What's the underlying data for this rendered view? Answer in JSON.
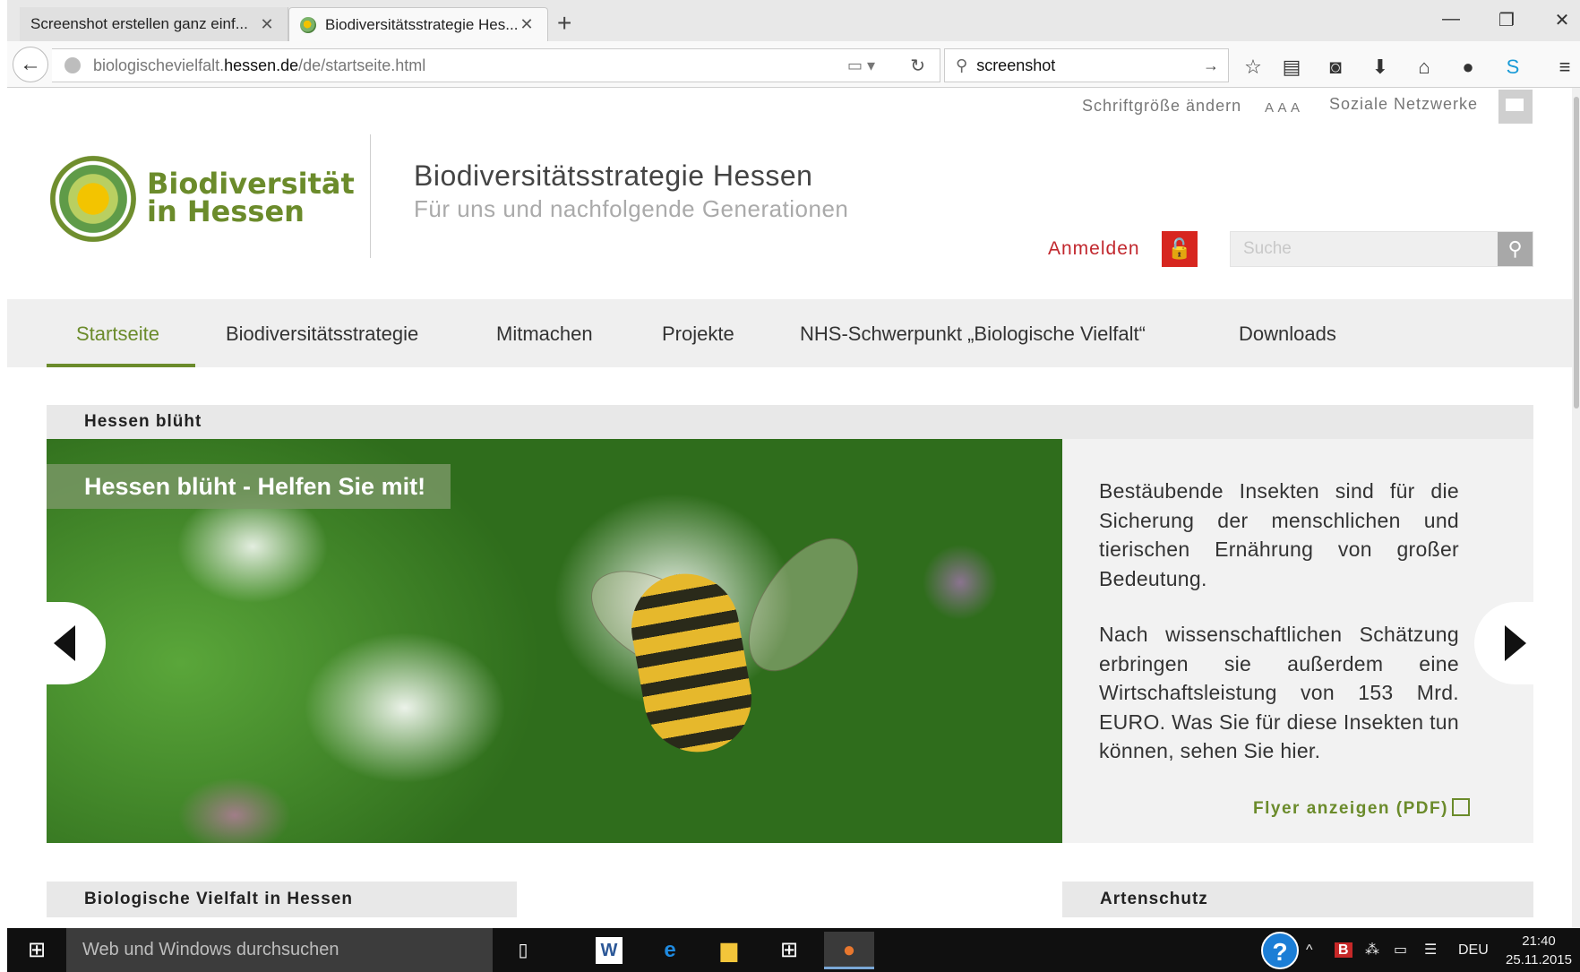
{
  "browser": {
    "tabs": [
      {
        "label": "Screenshot erstellen ganz einf...",
        "active": false
      },
      {
        "label": "Biodiversitätsstrategie Hes...",
        "active": true
      }
    ],
    "url": {
      "prefix": "biologischevielfalt.",
      "host": "hessen.de",
      "path": "/de/startseite.html"
    },
    "search_value": "screenshot",
    "icons": [
      "back-arrow-icon",
      "reader-icon",
      "reload-icon",
      "search-icon",
      "star-icon",
      "library-icon",
      "pocket-icon",
      "download-icon",
      "home-icon",
      "chat-icon",
      "skype-icon",
      "menu-icon"
    ]
  },
  "site": {
    "util": {
      "font_size": "Schriftgröße ändern",
      "font_size_controls": "A A A",
      "social": "Soziale Netzwerke"
    },
    "logo": {
      "line1": "Biodiversität",
      "line2": "in Hessen"
    },
    "title": "Biodiversitätsstrategie Hessen",
    "subtitle": "Für uns und nachfolgende Generationen",
    "login_label": "Anmelden",
    "search_placeholder": "Suche",
    "nav": [
      "Startseite",
      "Biodiversitätsstrategie",
      "Mitmachen",
      "Projekte",
      "NHS-Schwerpunkt „Biologische Vielfalt“",
      "Downloads"
    ],
    "active_nav": "Startseite",
    "accent_color": "#6b8b2b",
    "feature": {
      "heading": "Hessen blüht",
      "badge": "Hessen blüht - Helfen Sie mit!",
      "paragraph1": "Bestäubende Insekten sind für die Sicherung der menschlichen und tierischen Ernährung von großer Bedeutung.",
      "paragraph2": "Nach wissenschaftlichen Schätzung erbringen sie außerdem eine Wirtschaftsleistung von 153 Mrd. EURO. Was Sie für diese Insekten tun können, sehen Sie hier.",
      "flyer_link": "Flyer anzeigen (PDF)"
    },
    "lower_sections": [
      "Biologische Vielfalt in Hessen",
      "Artenschutz"
    ]
  },
  "taskbar": {
    "search_placeholder": "Web und Windows durchsuchen",
    "language": "DEU",
    "time": "21:40",
    "date": "25.11.2015"
  }
}
